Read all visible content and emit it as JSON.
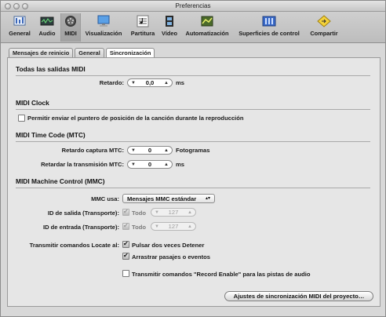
{
  "window": {
    "title": "Preferencias"
  },
  "toolbar": {
    "items": [
      {
        "label": "General",
        "icon": "general-icon"
      },
      {
        "label": "Audio",
        "icon": "audio-icon"
      },
      {
        "label": "MIDI",
        "icon": "midi-icon",
        "selected": true
      },
      {
        "label": "Visualización",
        "icon": "display-icon"
      },
      {
        "label": "Partitura",
        "icon": "score-icon"
      },
      {
        "label": "Vídeo",
        "icon": "video-icon"
      },
      {
        "label": "Automatización",
        "icon": "automation-icon"
      },
      {
        "label": "Superficies de control",
        "icon": "control-surfaces-icon"
      },
      {
        "label": "Compartir",
        "icon": "share-icon"
      }
    ]
  },
  "tabs": [
    {
      "label": "Mensajes de reinicio"
    },
    {
      "label": "General"
    },
    {
      "label": "Sincronización",
      "active": true
    }
  ],
  "sections": {
    "all_outputs": {
      "title": "Todas las salidas MIDI",
      "delay_label": "Retardo:",
      "delay_value": "0,0",
      "delay_unit": "ms"
    },
    "midi_clock": {
      "title": "MIDI Clock",
      "checkbox_label": "Permitir enviar el puntero de posición de la canción durante la reproducción",
      "checked": false
    },
    "mtc": {
      "title": "MIDI Time Code (MTC)",
      "capture_label": "Retardo captura MTC:",
      "capture_value": "0",
      "capture_unit": "Fotogramas",
      "transmit_label": "Retardar la transmisión MTC:",
      "transmit_value": "0",
      "transmit_unit": "ms"
    },
    "mmc": {
      "title": "MIDI Machine Control (MMC)",
      "mmc_label": "MMC usa:",
      "mmc_value": "Mensajes MMC estándar",
      "out_label": "ID de salida (Transporte):",
      "out_checkbox": "Todo",
      "out_value": "127",
      "in_label": "ID de entrada (Transporte):",
      "in_checkbox": "Todo",
      "in_value": "127",
      "locate_label": "Transmitir comandos Locate al:",
      "locate_option1": "Pulsar dos veces Detener",
      "locate_option2": "Arrastrar pasajes o eventos",
      "record_enable_label": "Transmitir comandos \"Record Enable\" para las pistas de audio"
    }
  },
  "footer": {
    "project_button": "Ajustes de sincronización MIDI del proyecto…"
  }
}
